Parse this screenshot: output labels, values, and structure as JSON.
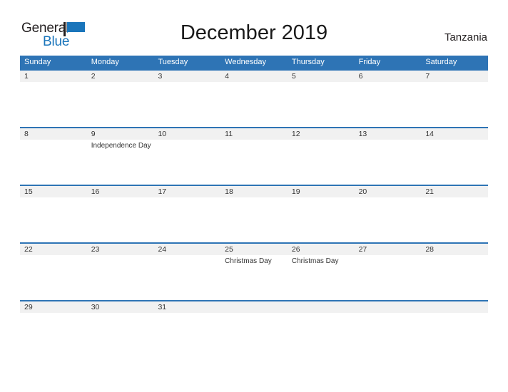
{
  "logo": {
    "word_one": "General",
    "word_two": "Blue",
    "icon": "flag-triangle-icon",
    "accent_color": "#1a75bb",
    "text_color": "#231f20"
  },
  "header": {
    "title": "December 2019",
    "country": "Tanzania"
  },
  "theme": {
    "header_blue": "#2e74b5",
    "row_band_gray": "#f1f1f1",
    "row_border_blue": "#2e74b5",
    "text_dark": "#333333"
  },
  "calendar": {
    "weekdays": [
      "Sunday",
      "Monday",
      "Tuesday",
      "Wednesday",
      "Thursday",
      "Friday",
      "Saturday"
    ],
    "weeks": [
      [
        {
          "date": "1",
          "events": []
        },
        {
          "date": "2",
          "events": []
        },
        {
          "date": "3",
          "events": []
        },
        {
          "date": "4",
          "events": []
        },
        {
          "date": "5",
          "events": []
        },
        {
          "date": "6",
          "events": []
        },
        {
          "date": "7",
          "events": []
        }
      ],
      [
        {
          "date": "8",
          "events": []
        },
        {
          "date": "9",
          "events": [
            "Independence Day"
          ]
        },
        {
          "date": "10",
          "events": []
        },
        {
          "date": "11",
          "events": []
        },
        {
          "date": "12",
          "events": []
        },
        {
          "date": "13",
          "events": []
        },
        {
          "date": "14",
          "events": []
        }
      ],
      [
        {
          "date": "15",
          "events": []
        },
        {
          "date": "16",
          "events": []
        },
        {
          "date": "17",
          "events": []
        },
        {
          "date": "18",
          "events": []
        },
        {
          "date": "19",
          "events": []
        },
        {
          "date": "20",
          "events": []
        },
        {
          "date": "21",
          "events": []
        }
      ],
      [
        {
          "date": "22",
          "events": []
        },
        {
          "date": "23",
          "events": []
        },
        {
          "date": "24",
          "events": []
        },
        {
          "date": "25",
          "events": [
            "Christmas Day"
          ]
        },
        {
          "date": "26",
          "events": [
            "Christmas Day"
          ]
        },
        {
          "date": "27",
          "events": []
        },
        {
          "date": "28",
          "events": []
        }
      ],
      [
        {
          "date": "29",
          "events": []
        },
        {
          "date": "30",
          "events": []
        },
        {
          "date": "31",
          "events": []
        },
        {
          "date": "",
          "events": []
        },
        {
          "date": "",
          "events": []
        },
        {
          "date": "",
          "events": []
        },
        {
          "date": "",
          "events": []
        }
      ]
    ]
  }
}
